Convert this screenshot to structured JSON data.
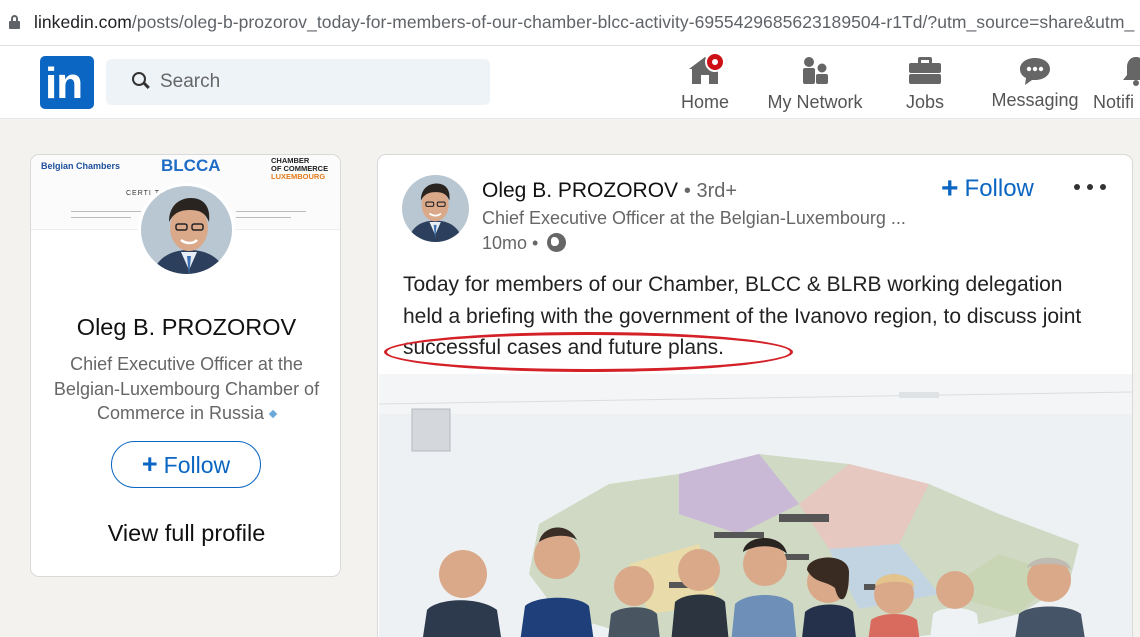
{
  "browser": {
    "url_main": "linkedin.com",
    "url_rest": "/posts/oleg-b-prozorov_today-for-members-of-our-chamber-blcc-activity-6955429685623189504-r1Td/?utm_source=share&utm_"
  },
  "nav": {
    "logo_text": "in",
    "search_placeholder": "Search",
    "items": [
      {
        "label": "Home",
        "icon": "home-icon",
        "badge": true
      },
      {
        "label": "My Network",
        "icon": "network-icon"
      },
      {
        "label": "Jobs",
        "icon": "briefcase-icon"
      },
      {
        "label": "Messaging",
        "icon": "messaging-icon"
      },
      {
        "label": "Notifi",
        "icon": "bell-icon"
      }
    ]
  },
  "profile_card": {
    "banner": {
      "logo_left": "Belgian Chambers",
      "logo_center": "BLCCA",
      "logo_right_line1": "CHAMBER",
      "logo_right_line2": "OF COMMERCE",
      "logo_right_line3": "LUXEMBOURG",
      "cert_text": "CERTI                    TATION"
    },
    "name": "Oleg B. PROZOROV",
    "headline": "Chief Executive Officer at the Belgian-Luxembourg Chamber of Commerce in Russia",
    "follow_label": "Follow",
    "view_profile_label": "View full profile"
  },
  "post": {
    "author_name": "Oleg B. PROZOROV",
    "degree": "• 3rd+",
    "author_title": "Chief Executive Officer at the Belgian-Luxembourg ...",
    "time": "10mo •",
    "follow_label": "Follow",
    "text": "Today for members of our Chamber, BLCC & BLRB working delegation held a briefing with the government of the Ivanovo region, to discuss joint successful cases and future plans.",
    "colors": {
      "accent": "#0a66c2",
      "highlight": "#d42027"
    }
  }
}
